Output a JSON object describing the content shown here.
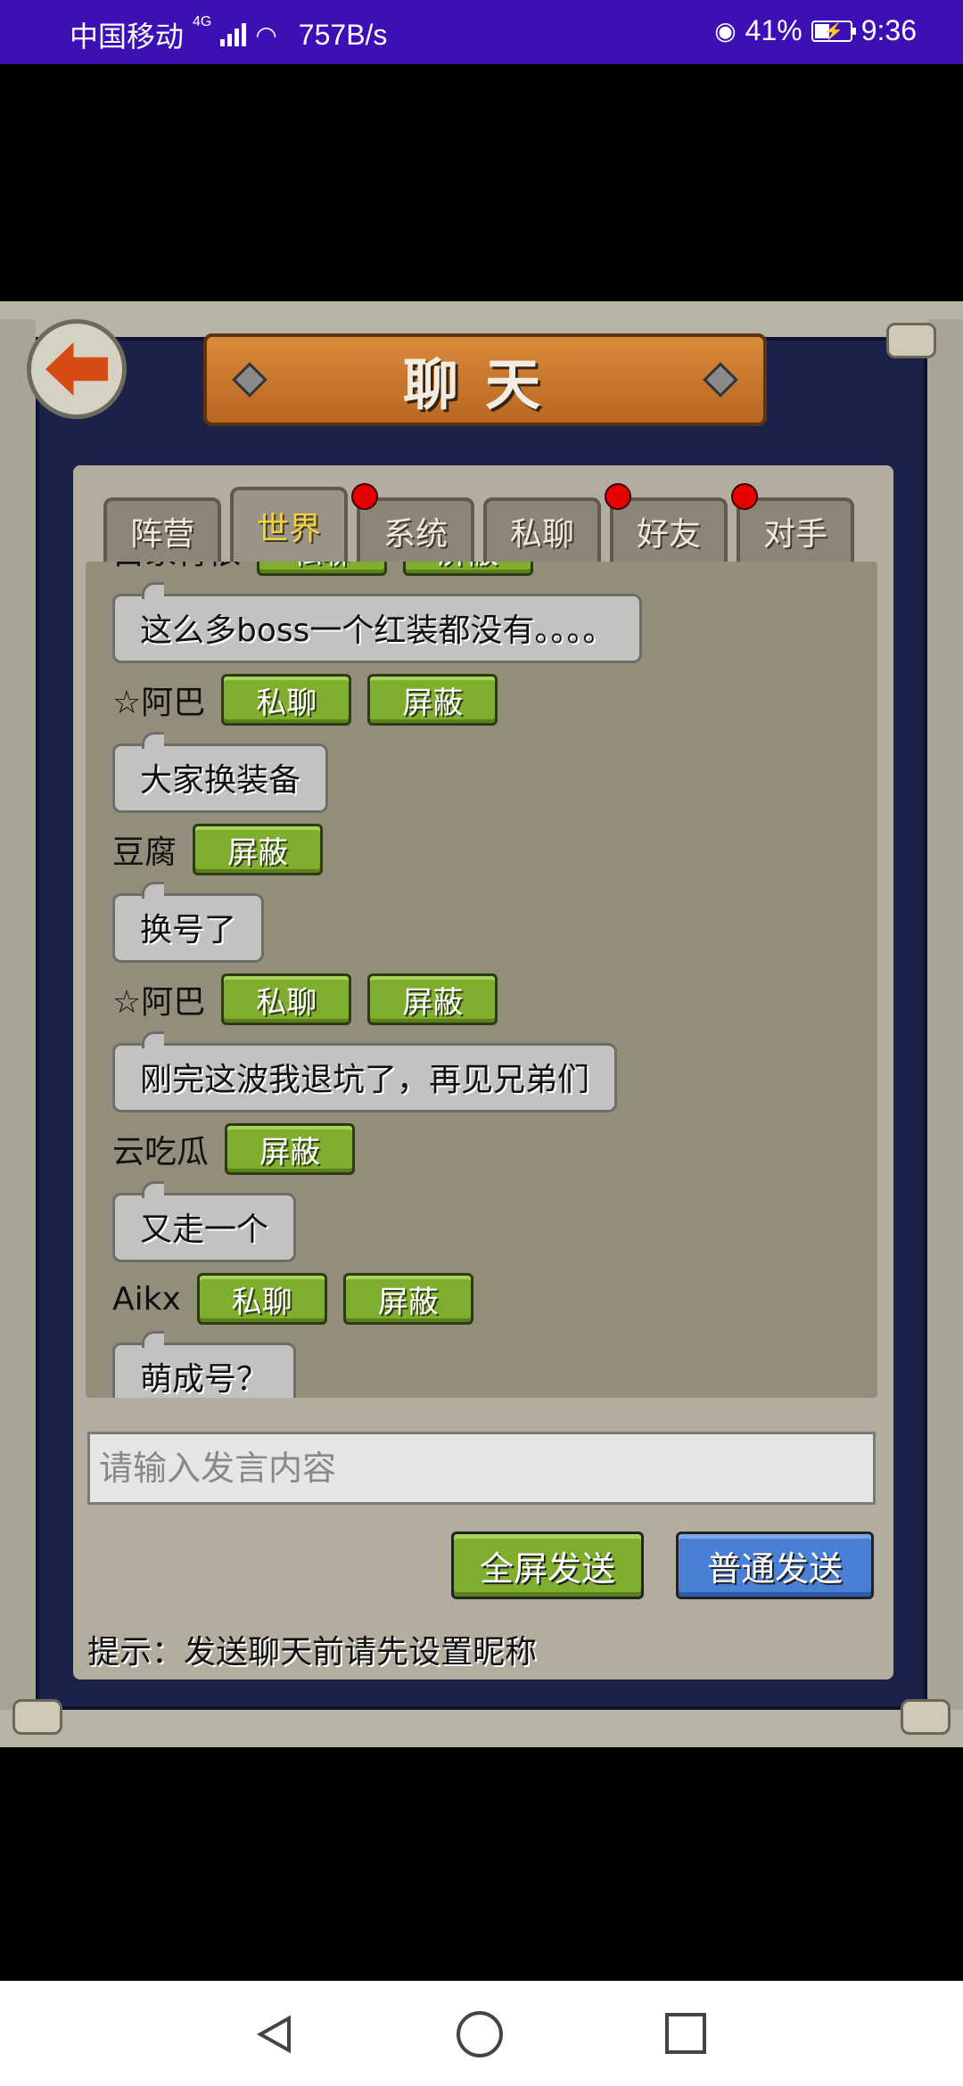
{
  "status_bar": {
    "carrier": "中国移动",
    "network": "4G",
    "speed": "757B/s",
    "battery": "41%",
    "battery_level": 0.41,
    "time": "9:36"
  },
  "header": {
    "title": "聊天"
  },
  "tabs": [
    {
      "label": "阵营",
      "active": false,
      "badge": false
    },
    {
      "label": "世界",
      "active": true,
      "badge": false
    },
    {
      "label": "系统",
      "active": false,
      "badge": true
    },
    {
      "label": "私聊",
      "active": false,
      "badge": false
    },
    {
      "label": "好友",
      "active": false,
      "badge": true
    },
    {
      "label": "对手",
      "active": false,
      "badge": true
    }
  ],
  "messages": [
    {
      "nick": "白家青依",
      "buttons": [
        "私聊",
        "屏蔽"
      ],
      "text": "这么多boss一个红装都没有。。。。"
    },
    {
      "nick": "☆阿巴",
      "buttons": [
        "私聊",
        "屏蔽"
      ],
      "text": "大家换装备"
    },
    {
      "nick": "豆腐",
      "buttons": [
        "屏蔽"
      ],
      "text": "换号了"
    },
    {
      "nick": "☆阿巴",
      "buttons": [
        "私聊",
        "屏蔽"
      ],
      "text": "刚完这波我退坑了，再见兄弟们"
    },
    {
      "nick": "云吃瓜",
      "buttons": [
        "屏蔽"
      ],
      "text": "又走一个"
    },
    {
      "nick": "Aikx",
      "buttons": [
        "私聊",
        "屏蔽"
      ],
      "text": "萌成号？"
    }
  ],
  "input": {
    "placeholder": "请输入发言内容"
  },
  "buttons": {
    "fullscreen_send": "全屏发送",
    "normal_send": "普通发送"
  },
  "hint": "提示：发送聊天前请先设置昵称"
}
